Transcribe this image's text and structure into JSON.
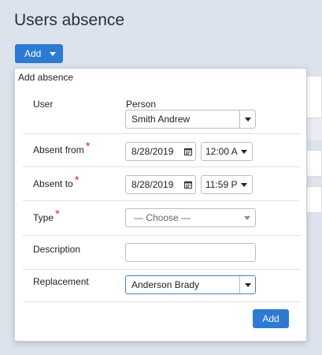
{
  "page": {
    "title": "Users absence"
  },
  "toolbar": {
    "add_label": "Add"
  },
  "popover": {
    "title": "Add absence",
    "user": {
      "label": "User",
      "sublabel": "Person",
      "value": "Smith Andrew"
    },
    "absent_from": {
      "label": "Absent from",
      "required": "*",
      "date": "8/28/2019",
      "time": "12:00 A"
    },
    "absent_to": {
      "label": "Absent to",
      "required": "*",
      "date": "8/28/2019",
      "time": "11:59 P"
    },
    "type": {
      "label": "Type",
      "required": "*",
      "placeholder": "— Choose —"
    },
    "description": {
      "label": "Description",
      "value": ""
    },
    "replacement": {
      "label": "Replacement",
      "value": "Anderson Brady"
    },
    "submit_label": "Add"
  },
  "colors": {
    "accent": "#2b7ad6",
    "required": "#d4343a"
  }
}
